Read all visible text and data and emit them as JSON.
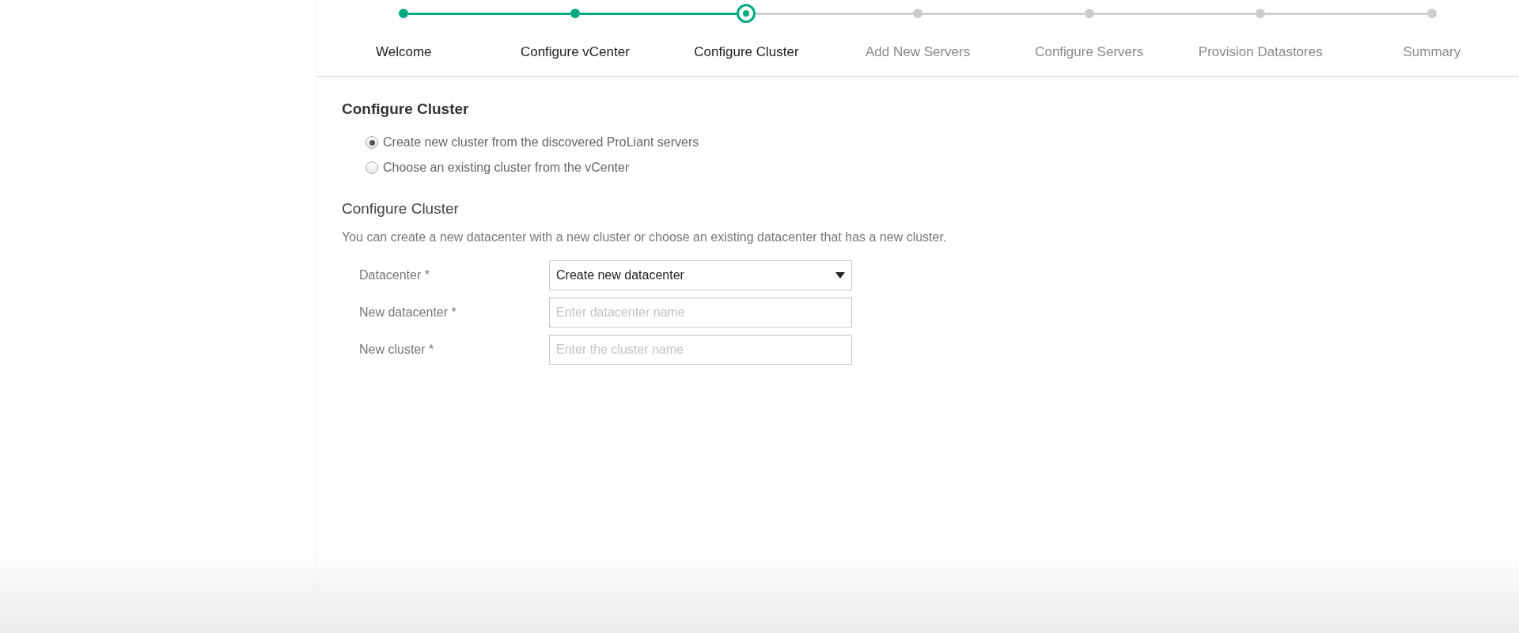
{
  "stepper": [
    {
      "label": "Welcome",
      "kind": "done"
    },
    {
      "label": "Configure vCenter",
      "kind": "done"
    },
    {
      "label": "Configure Cluster",
      "kind": "current"
    },
    {
      "label": "Add New Servers",
      "kind": "upcoming"
    },
    {
      "label": "Configure Servers",
      "kind": "upcoming"
    },
    {
      "label": "Provision Datastores",
      "kind": "upcoming"
    },
    {
      "label": "Summary",
      "kind": "upcoming"
    }
  ],
  "heading": "Configure Cluster",
  "options": [
    {
      "label": "Create new cluster from the discovered ProLiant servers",
      "selected": true
    },
    {
      "label": "Choose an existing cluster from the vCenter",
      "selected": false
    }
  ],
  "section": {
    "title": "Configure Cluster",
    "description": "You can create a new datacenter with a new cluster or choose an existing datacenter that has a new cluster."
  },
  "fields": [
    {
      "kind": "select",
      "label": "Datacenter *",
      "value": "Create new datacenter"
    },
    {
      "kind": "text",
      "label": "New datacenter *",
      "placeholder": "Enter datacenter name"
    },
    {
      "kind": "text",
      "label": "New cluster *",
      "placeholder": "Enter the cluster name"
    }
  ]
}
